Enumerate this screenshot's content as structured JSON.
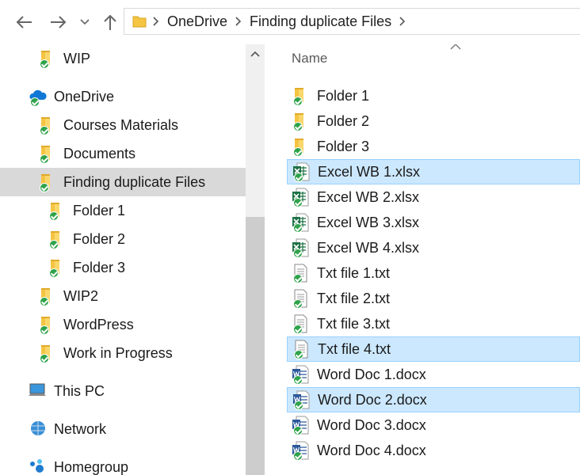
{
  "toolbar": {
    "back_icon": "arrow-left-icon",
    "forward_icon": "arrow-right-icon",
    "recent_icon": "chevron-down-icon",
    "up_icon": "arrow-up-icon",
    "breadcrumb": [
      "OneDrive",
      "Finding duplicate Files"
    ]
  },
  "nav": {
    "items": [
      {
        "label": "WIP",
        "icon": "synced-folder-icon"
      },
      {
        "label": "OneDrive",
        "icon": "onedrive-cloud-icon"
      },
      {
        "label": "Courses Materials",
        "icon": "synced-folder-icon"
      },
      {
        "label": "Documents",
        "icon": "synced-folder-icon"
      },
      {
        "label": "Finding duplicate Files",
        "icon": "synced-folder-icon",
        "selected": true
      },
      {
        "label": "Folder 1",
        "icon": "synced-folder-icon"
      },
      {
        "label": "Folder 2",
        "icon": "synced-folder-icon"
      },
      {
        "label": "Folder 3",
        "icon": "synced-folder-icon"
      },
      {
        "label": "WIP2",
        "icon": "synced-folder-icon"
      },
      {
        "label": "WordPress",
        "icon": "synced-folder-icon"
      },
      {
        "label": "Work in Progress",
        "icon": "synced-folder-icon"
      },
      {
        "label": "This PC",
        "icon": "computer-icon"
      },
      {
        "label": "Network",
        "icon": "network-icon"
      },
      {
        "label": "Homegroup",
        "icon": "homegroup-icon"
      }
    ]
  },
  "content": {
    "column_header": "Name",
    "files": [
      {
        "name": "Folder 1",
        "type": "folder"
      },
      {
        "name": "Folder 2",
        "type": "folder"
      },
      {
        "name": "Folder 3",
        "type": "folder"
      },
      {
        "name": "Excel WB 1.xlsx",
        "type": "excel",
        "selected": true
      },
      {
        "name": "Excel WB 2.xlsx",
        "type": "excel"
      },
      {
        "name": "Excel WB 3.xlsx",
        "type": "excel"
      },
      {
        "name": "Excel WB 4.xlsx",
        "type": "excel"
      },
      {
        "name": "Txt file 1.txt",
        "type": "text"
      },
      {
        "name": "Txt file 2.txt",
        "type": "text"
      },
      {
        "name": "Txt file 3.txt",
        "type": "text"
      },
      {
        "name": "Txt file 4.txt",
        "type": "text",
        "selected": true
      },
      {
        "name": "Word Doc 1.docx",
        "type": "word"
      },
      {
        "name": "Word Doc 2.docx",
        "type": "word",
        "selected": true
      },
      {
        "name": "Word Doc 3.docx",
        "type": "word"
      },
      {
        "name": "Word Doc 4.docx",
        "type": "word"
      }
    ]
  },
  "colors": {
    "selection_bg": "#cce8ff",
    "selection_border": "#99d1ff",
    "nav_selected_bg": "#d9d9d9",
    "sync_green": "#2fa34a",
    "folder_yellow": "#f4c542"
  }
}
